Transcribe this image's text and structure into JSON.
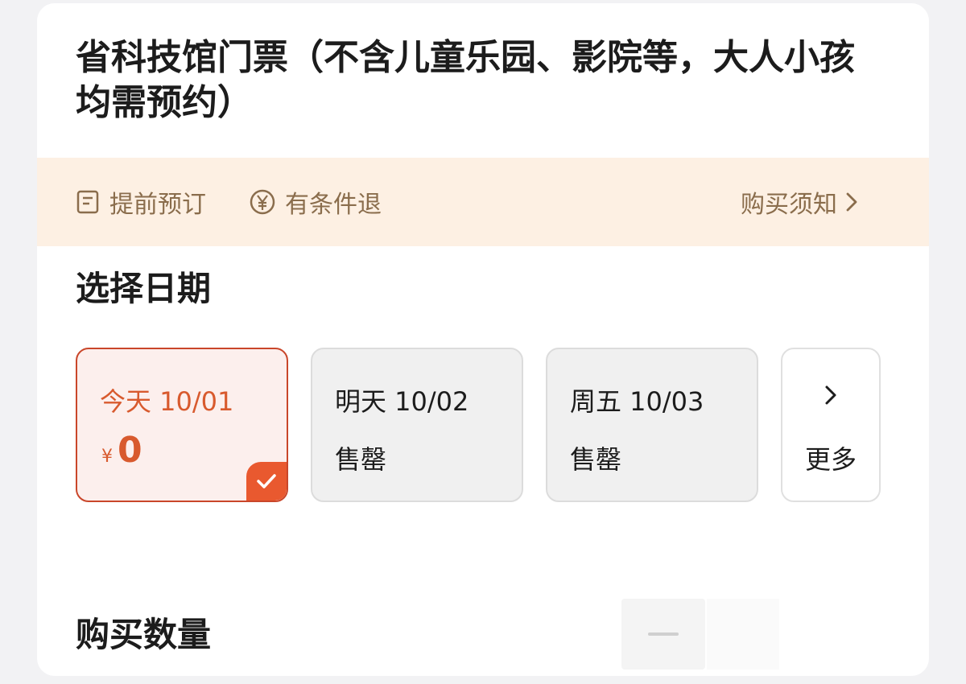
{
  "product": {
    "title": "省科技馆门票（不含儿童乐园、影院等，大人小孩均需预约）"
  },
  "info_bar": {
    "prebook_label": "提前预订",
    "refund_label": "有条件退",
    "notice_label": "购买须知",
    "prebook_icon": "receipt-icon",
    "refund_icon": "yen-circle-icon",
    "notice_icon": "chevron-right-icon",
    "background": "#fdf0e3",
    "text_color": "#8a6d4c"
  },
  "date_section": {
    "title": "选择日期",
    "dates": [
      {
        "label": "今天 10/01",
        "currency": "¥",
        "price": "0",
        "selected": true
      },
      {
        "label": "明天 10/02",
        "status": "售罄",
        "selected": false
      },
      {
        "label": "周五 10/03",
        "status": "售罄",
        "selected": false
      }
    ],
    "more_label": "更多",
    "accent": "#d85a2e"
  },
  "quantity_section": {
    "title": "购买数量"
  }
}
